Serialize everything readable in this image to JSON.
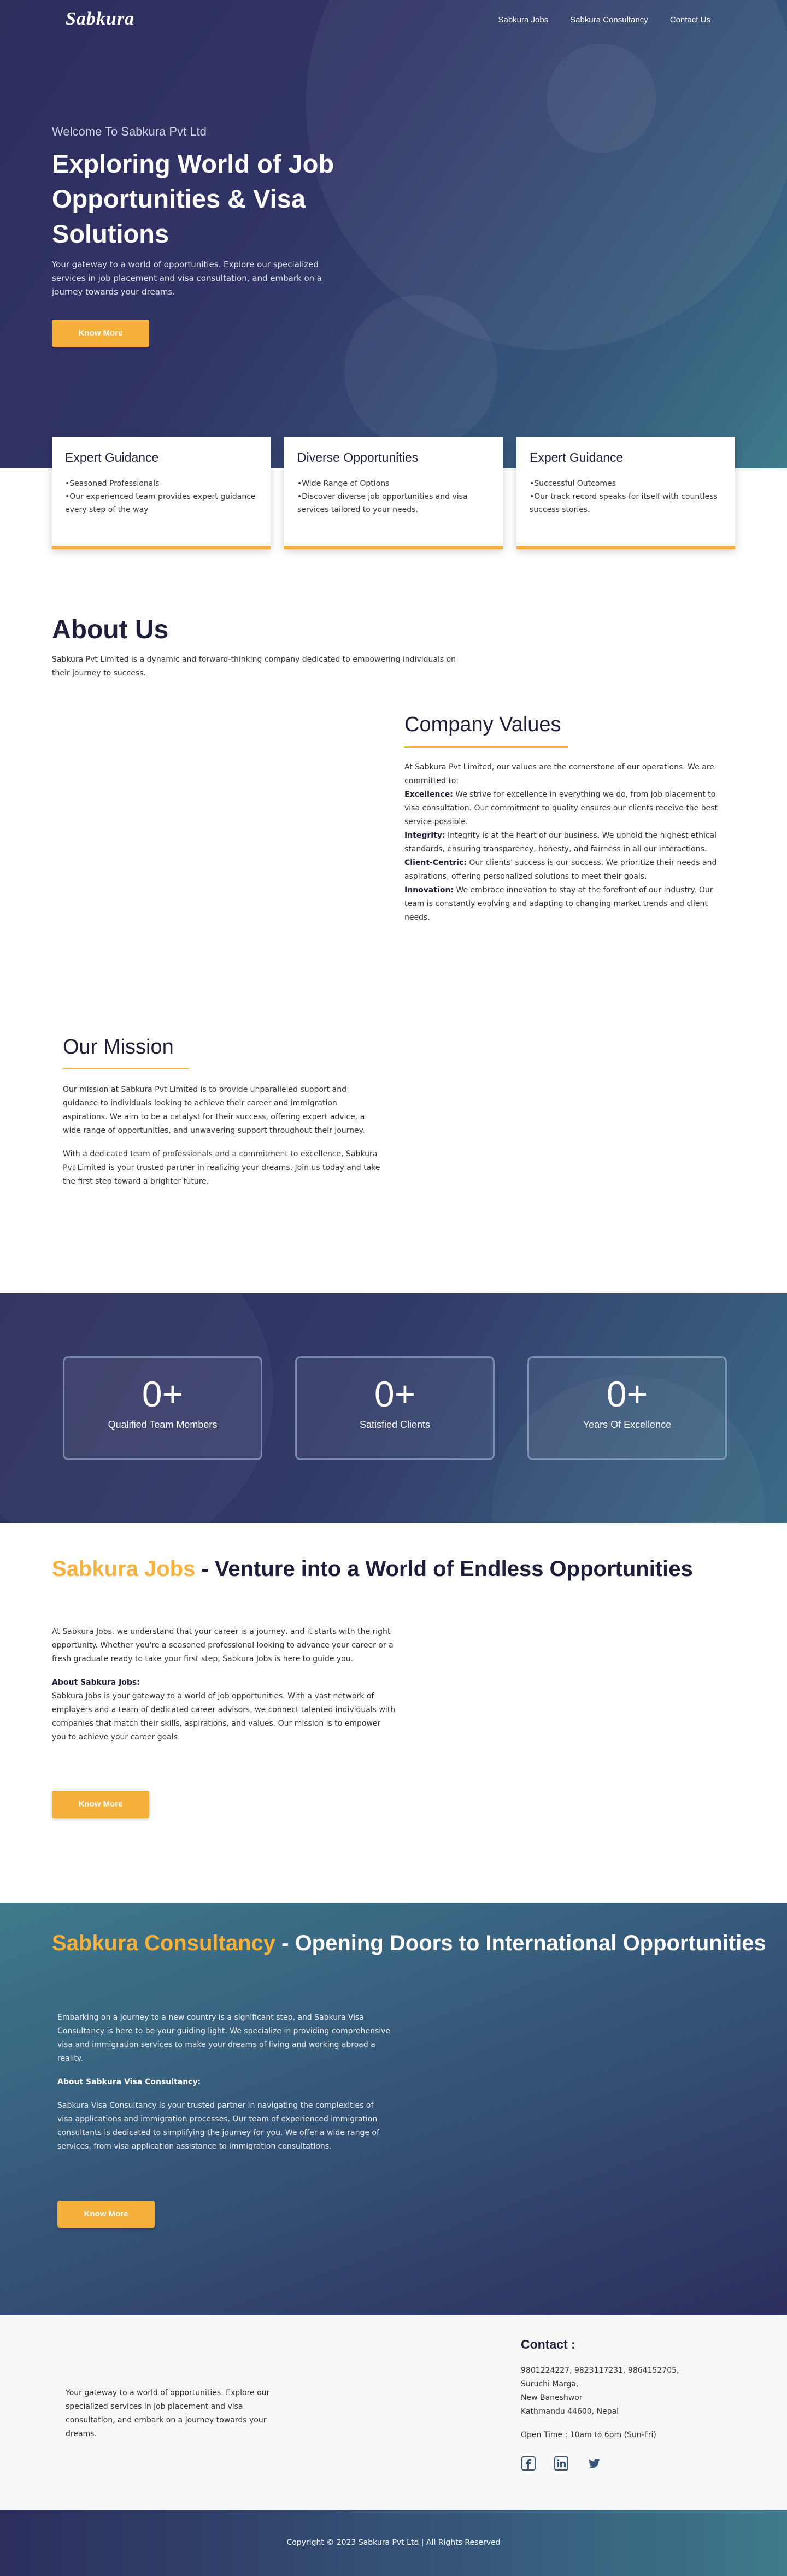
{
  "brand": {
    "logo": "Sabkura"
  },
  "nav": {
    "links": [
      "Sabkura Jobs",
      "Sabkura Consultancy",
      "Contact Us"
    ]
  },
  "hero": {
    "welcome": "Welcome To Sabkura Pvt Ltd",
    "title": "Exploring World of Job Opportunities & Visa Solutions",
    "description": "Your gateway to a world of opportunities. Explore our specialized services in job placement and visa consultation, and embark on a journey towards your dreams.",
    "button": "Know More"
  },
  "features": [
    {
      "title": "Expert Guidance",
      "line1": "•Seasoned Professionals",
      "line2": "•Our experienced team provides expert guidance every step of the way"
    },
    {
      "title": "Diverse Opportunities",
      "line1": "•Wide Range of Options",
      "line2": "•Discover diverse job opportunities and visa services tailored to your needs."
    },
    {
      "title": "Expert Guidance",
      "line1": "•Successful Outcomes",
      "line2": "•Our track record speaks for itself with countless success stories."
    }
  ],
  "about": {
    "title": "About Us",
    "description": "Sabkura Pvt Limited is a dynamic and forward-thinking company dedicated to empowering individuals on their journey to success."
  },
  "values": {
    "title": "Company Values",
    "intro": "At Sabkura Pvt Limited, our values are the cornerstone of our operations. We are committed to:",
    "items": [
      {
        "label": "Excellence:",
        "text": " We strive for excellence in everything we do, from job placement to visa consultation. Our commitment to quality ensures our clients receive the best service possible."
      },
      {
        "label": "Integrity:",
        "text": " Integrity is at the heart of our business. We uphold the highest ethical standards, ensuring transparency, honesty, and fairness in all our interactions."
      },
      {
        "label": "Client-Centric:",
        "text": " Our clients' success is our success. We prioritize their needs and aspirations, offering personalized solutions to meet their goals."
      },
      {
        "label": "Innovation:",
        "text": " We embrace innovation to stay at the forefront of our industry. Our team is constantly evolving and adapting to changing market trends and client needs."
      }
    ]
  },
  "mission": {
    "title": "Our Mission",
    "p1": "Our mission at Sabkura Pvt Limited is to provide unparalleled support and guidance to individuals looking to achieve their career and immigration aspirations. We aim to be a catalyst for their success, offering expert advice, a wide range of opportunities, and unwavering support throughout their journey.",
    "p2": "With a dedicated team of professionals and a commitment to excellence, Sabkura Pvt Limited is your trusted partner in realizing your dreams. Join us today and take the first step toward a brighter future."
  },
  "stats": [
    {
      "value": "0+",
      "label": "Qualified Team Members"
    },
    {
      "value": "0+",
      "label": "Satisfied Clients"
    },
    {
      "value": "0+",
      "label": "Years Of Excellence"
    }
  ],
  "jobs": {
    "title_accent": "Sabkura Jobs",
    "title_rest": " - Venture into a World of Endless Opportunities",
    "p1": "At Sabkura Jobs, we understand that your career is a journey, and it starts with the right opportunity. Whether you're a seasoned professional looking to advance your career or a fresh graduate ready to take your first step, Sabkura Jobs is here to guide you.",
    "subheading": "About Sabkura Jobs:",
    "p2": "Sabkura Jobs is your gateway to a world of job opportunities. With a vast network of employers and a team of dedicated career advisors, we connect talented individuals with companies that match their skills, aspirations, and values. Our mission is to empower you to achieve your career goals.",
    "button": "Know More"
  },
  "consultancy": {
    "title_accent": "Sabkura Consultancy",
    "title_rest": " - Opening Doors to International Opportunities",
    "p1": "Embarking on a journey to a new country is a significant step, and Sabkura Visa Consultancy is here to be your guiding light. We specialize in providing comprehensive visa and immigration services to make your dreams of living and working abroad a reality.",
    "subheading": "About Sabkura Visa Consultancy:",
    "p2": "Sabkura Visa Consultancy is your trusted partner in navigating the complexities of visa applications and immigration processes. Our team of experienced immigration consultants is dedicated to simplifying the journey for you. We offer a wide range of services, from visa application assistance to immigration consultations.",
    "button": "Know More"
  },
  "footer": {
    "tagline": "Your gateway to a world of opportunities. Explore our specialized services in job placement and visa consultation, and embark on a journey towards your dreams.",
    "contact_title": "Contact :",
    "phones": "9801224227, 9823117231, 9864152705,",
    "address1": "Suruchi Marga,",
    "address2": "New Baneshwor",
    "address3": "Kathmandu 44600, Nepal",
    "hours": "Open Time : 10am to 6pm (Sun-Fri)",
    "socials": [
      "facebook-icon",
      "linkedin-icon",
      "twitter-icon"
    ],
    "copyright": "Copyright © 2023 Sabkura Pvt Ltd | All Rights Reserved"
  },
  "colors": {
    "accent": "#f6b13d",
    "navy": "#2c2e5c",
    "teal": "#3e7a8c"
  }
}
